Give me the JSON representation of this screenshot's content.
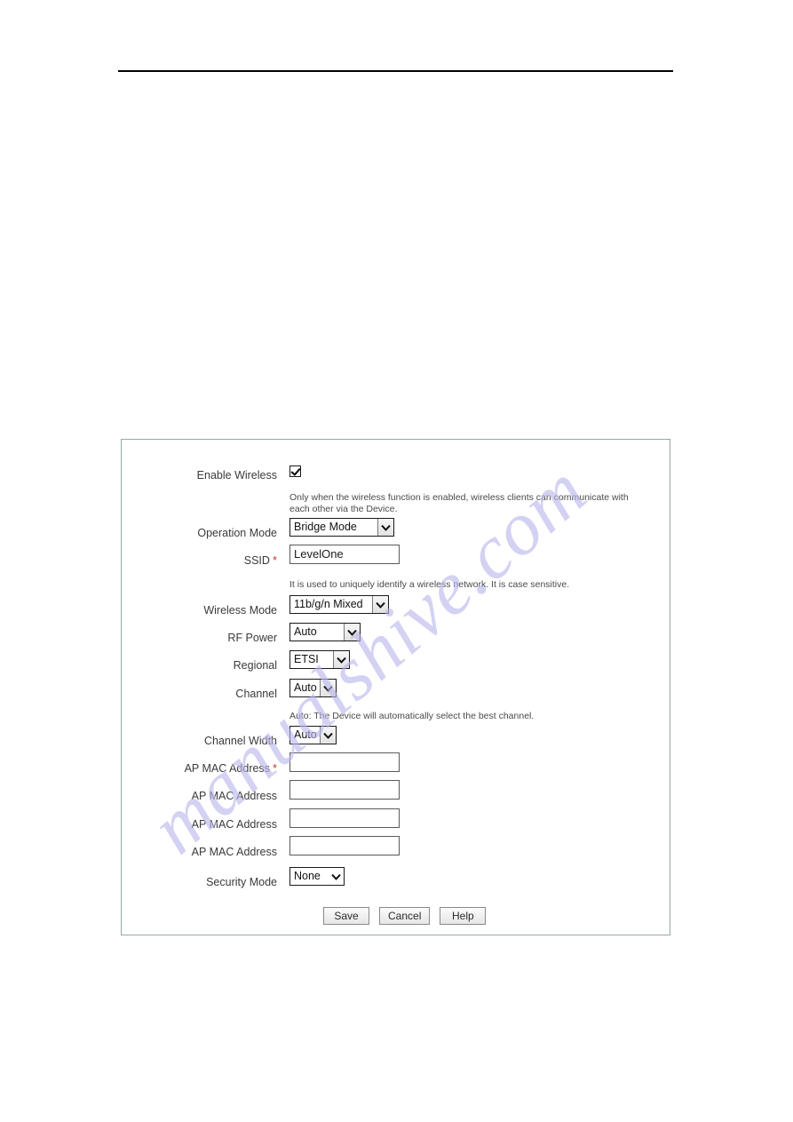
{
  "page": {
    "watermark": "manualshive.com",
    "has_header_rule": true
  },
  "panel": {
    "border_color": "#93a9a6",
    "fields": [
      {
        "id": "enable-wireless",
        "label": "Enable Wireless",
        "type": "checkbox",
        "checked": true,
        "helper": "Only when the wireless function is enabled, wireless clients can communicate with each other via the Device."
      },
      {
        "id": "operation-mode",
        "label": "Operation Mode",
        "type": "select",
        "value": "Bridge Mode"
      },
      {
        "id": "ssid",
        "label": "SSID",
        "required": true,
        "required_marker": "*",
        "type": "text",
        "value": "LevelOne",
        "helper": "It is used to uniquely identify a wireless network. It is case sensitive."
      },
      {
        "id": "wireless-mode",
        "label": "Wireless Mode",
        "type": "select",
        "value": "11b/g/n Mixed"
      },
      {
        "id": "rf-power",
        "label": "RF Power",
        "type": "select",
        "value": "Auto"
      },
      {
        "id": "regional",
        "label": "Regional",
        "type": "select",
        "value": "ETSI"
      },
      {
        "id": "channel",
        "label": "Channel",
        "type": "select",
        "value": "Auto",
        "helper": "Auto: The Device will automatically select the best channel."
      },
      {
        "id": "channel-width",
        "label": "Channel Width",
        "type": "select",
        "value": "Auto"
      },
      {
        "id": "ap-mac-address-1",
        "label": "AP MAC Address",
        "required": true,
        "required_marker": "*",
        "type": "text",
        "value": ""
      },
      {
        "id": "ap-mac-address-2",
        "label": "AP MAC Address",
        "type": "text",
        "value": ""
      },
      {
        "id": "ap-mac-address-3",
        "label": "AP MAC Address",
        "type": "text",
        "value": ""
      },
      {
        "id": "ap-mac-address-4",
        "label": "AP MAC Address",
        "type": "text",
        "value": ""
      },
      {
        "id": "security-mode",
        "label": "Security Mode",
        "type": "select",
        "value": "None"
      }
    ],
    "buttons": [
      {
        "id": "save",
        "label": "Save"
      },
      {
        "id": "cancel",
        "label": "Cancel"
      },
      {
        "id": "help",
        "label": "Help"
      }
    ]
  }
}
